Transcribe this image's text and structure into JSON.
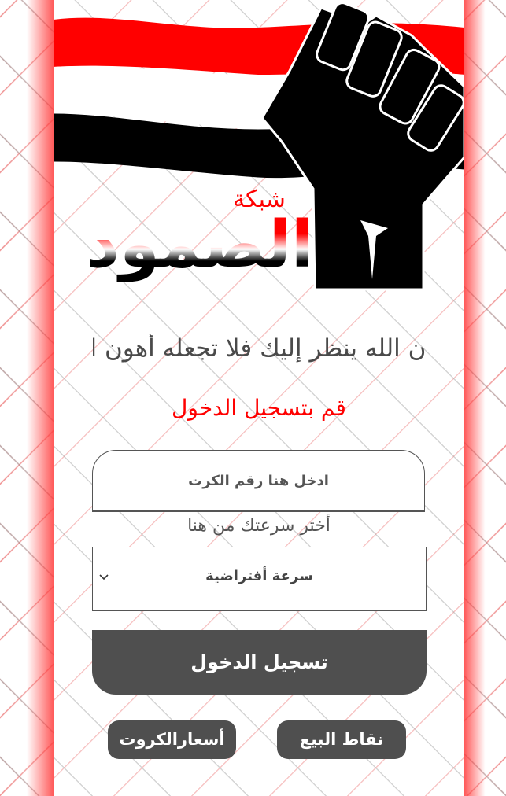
{
  "brand": {
    "network_label": "شبكة",
    "name": "الصمود"
  },
  "marquee_text": "إن الله ينظر إليك فلا تجعله أهون الناظرين إليك",
  "subtitle": "قم بتسجيل الدخول",
  "form": {
    "card_input_placeholder": "ادخل هنا رقم الكرت",
    "card_input_value": "",
    "speed_label": "أختر سرعتك من هنا",
    "speed_selected": "سرعة أفتراضية",
    "login_button": "تسجيل الدخول"
  },
  "footer_buttons": {
    "sales_points": "نقاط البيع",
    "card_prices": "أسعارالكروت"
  },
  "colors": {
    "accent_red": "#ff0000",
    "button_gray": "#4f4f4f",
    "text_gray": "#555555"
  }
}
